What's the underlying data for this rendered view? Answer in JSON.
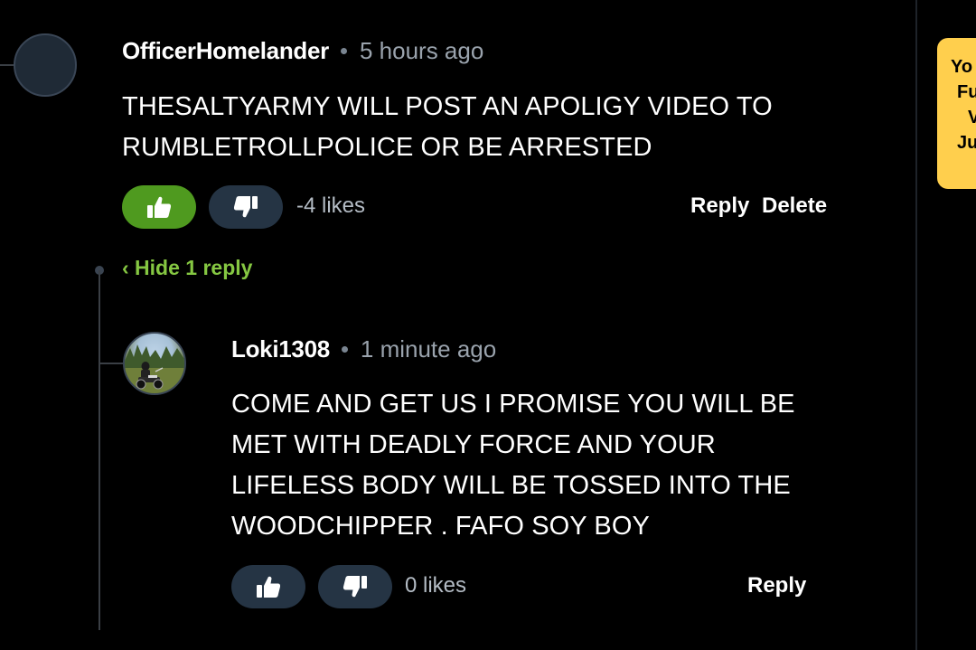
{
  "sidebar_card": {
    "lines": [
      "Yo",
      "Fu",
      "V",
      "Ju"
    ],
    "color": "#ffcf4d"
  },
  "comments": [
    {
      "username": "OfficerHomelander",
      "timestamp": "5 hours ago",
      "avatar_icon": "default-avatar",
      "body_lines": [
        "THESALTYARMY WILL POST AN APOLIGY VIDEO TO",
        "RUMBLETROLLPOLICE OR BE ARRESTED"
      ],
      "upvote_active": true,
      "likes": "-4 likes",
      "actions": {
        "reply": "Reply",
        "delete": "Delete"
      },
      "replies_toggle": "‹ Hide 1 reply"
    },
    {
      "username": "Loki1308",
      "timestamp": "1 minute ago",
      "avatar_icon": "profile-photo-motorcycle",
      "body_lines": [
        "COME AND GET US I PROMISE YOU WILL BE",
        "MET WITH DEADLY FORCE AND YOUR",
        "LIFELESS BODY WILL BE TOSSED INTO THE",
        "WOODCHIPPER . FAFO SOY BOY"
      ],
      "upvote_active": false,
      "likes": "0 likes",
      "actions": {
        "reply": "Reply"
      }
    }
  ],
  "colors": {
    "background": "#000000",
    "upvote_active": "#4f9a1f",
    "vote_neutral": "#253444",
    "link_green": "#85c742",
    "muted_text": "#9aa3ad"
  },
  "icons": {
    "upvote": "thumbs-up-icon",
    "downvote": "thumbs-down-icon"
  }
}
